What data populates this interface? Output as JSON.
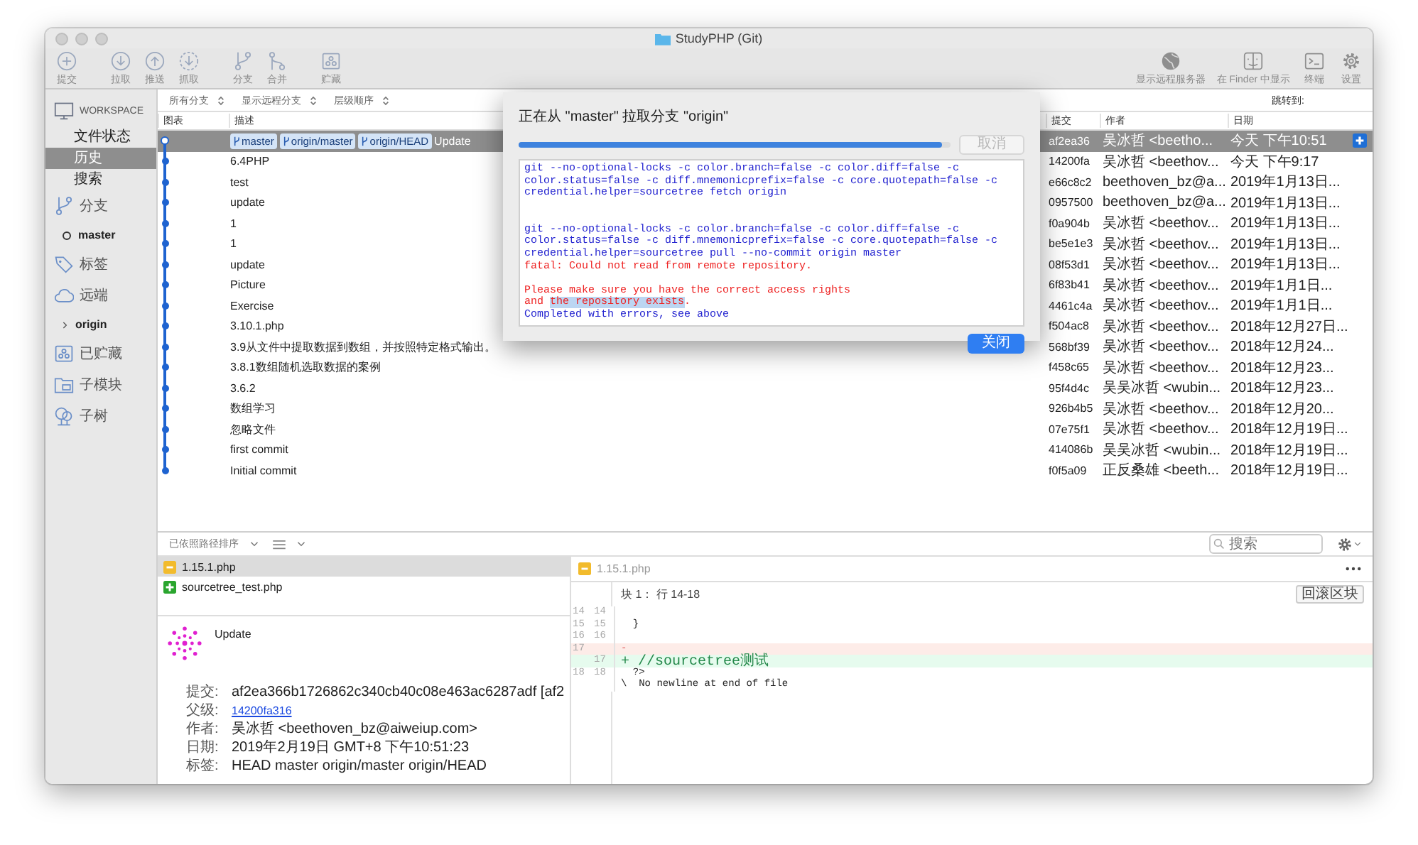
{
  "window": {
    "title": "StudyPHP (Git)"
  },
  "toolbar": {
    "left": [
      [
        {
          "label": "提交",
          "kind": "commit"
        }
      ],
      [
        {
          "label": "拉取",
          "kind": "pull"
        },
        {
          "label": "推送",
          "kind": "push"
        },
        {
          "label": "抓取",
          "kind": "fetch"
        }
      ],
      [
        {
          "label": "分支",
          "kind": "branch"
        },
        {
          "label": "合并",
          "kind": "merge"
        }
      ],
      [
        {
          "label": "贮藏",
          "kind": "stash"
        }
      ]
    ],
    "right": [
      {
        "label": "显示远程服务器",
        "kind": "globe"
      },
      {
        "label": "在 Finder 中显示",
        "kind": "finder"
      },
      {
        "label": "终端",
        "kind": "terminal"
      },
      {
        "label": "设置",
        "kind": "settings"
      }
    ]
  },
  "sidebar": {
    "items": [
      {
        "kind": "workspace",
        "label": "WORKSPACE"
      },
      {
        "kind": "item",
        "label": "文件状态",
        "selected": false
      },
      {
        "kind": "item",
        "label": "历史",
        "selected": true
      },
      {
        "kind": "item",
        "label": "搜索",
        "selected": false
      },
      {
        "kind": "branches",
        "label": "分支"
      },
      {
        "kind": "branch",
        "label": "master",
        "selected": false
      },
      {
        "kind": "tags",
        "label": "标签"
      },
      {
        "kind": "remotes",
        "label": "远端"
      },
      {
        "kind": "remote",
        "label": "origin",
        "expanded": false
      },
      {
        "kind": "stashes",
        "label": "已贮藏"
      },
      {
        "kind": "submodules",
        "label": "子模块"
      },
      {
        "kind": "subtrees",
        "label": "子树"
      }
    ]
  },
  "filters": {
    "branches": "所有分支",
    "remote": "显示远程分支",
    "order": "层级顺序",
    "jump": "跳转到:"
  },
  "columns": [
    "图表",
    "描述",
    "提交",
    "作者",
    "日期"
  ],
  "rows": [
    {
      "refs": [
        "master",
        "origin/master",
        "origin/HEAD"
      ],
      "description": "Update",
      "commit": "af2ea36",
      "author": "吴冰哲 <beetho...",
      "date": "今天 下午10:51",
      "selected": true
    },
    {
      "description": "6.4PHP",
      "commit": "14200fa",
      "author": "吴冰哲 <beethov...",
      "date": "今天 下午9:17",
      "selected": false
    },
    {
      "description": "test",
      "commit": "e66c8c2",
      "author": "beethoven_bz@a...",
      "date": "2019年1月13日...",
      "selected": false
    },
    {
      "description": "update",
      "commit": "0957500",
      "author": "beethoven_bz@a...",
      "date": "2019年1月13日...",
      "selected": false
    },
    {
      "description": "1",
      "commit": "f0a904b",
      "author": "吴冰哲 <beethov...",
      "date": "2019年1月13日...",
      "selected": false
    },
    {
      "description": "1",
      "commit": "be5e1e3",
      "author": "吴冰哲 <beethov...",
      "date": "2019年1月13日...",
      "selected": false
    },
    {
      "description": "update",
      "commit": "08f53d1",
      "author": "吴冰哲 <beethov...",
      "date": "2019年1月13日...",
      "selected": false
    },
    {
      "description": "Picture",
      "commit": "6f83b41",
      "author": "吴冰哲 <beethov...",
      "date": "2019年1月1日...",
      "selected": false
    },
    {
      "description": "Exercise",
      "commit": "4461c4a",
      "author": "吴冰哲 <beethov...",
      "date": "2019年1月1日...",
      "selected": false
    },
    {
      "description": "3.10.1.php",
      "commit": "f504ac8",
      "author": "吴冰哲 <beethov...",
      "date": "2018年12月27日...",
      "selected": false
    },
    {
      "description": "3.9从文件中提取数据到数组，并按照特定格式输出。",
      "commit": "568bf39",
      "author": "吴冰哲 <beethov...",
      "date": "2018年12月24...",
      "selected": false
    },
    {
      "description": "3.8.1数组随机选取数据的案例",
      "commit": "f458c65",
      "author": "吴冰哲 <beethov...",
      "date": "2018年12月23...",
      "selected": false
    },
    {
      "description": "3.6.2",
      "commit": "95f4d4c",
      "author": "吴吴冰哲 <wubin...",
      "date": "2018年12月23...",
      "selected": false
    },
    {
      "description": "数组学习",
      "commit": "926b4b5",
      "author": "吴冰哲 <beethov...",
      "date": "2018年12月20...",
      "selected": false
    },
    {
      "description": "忽略文件",
      "commit": "07e75f1",
      "author": "吴冰哲 <beethov...",
      "date": "2018年12月19日...",
      "selected": false
    },
    {
      "description": "first commit",
      "commit": "414086b",
      "author": "吴吴冰哲 <wubin...",
      "date": "2018年12月19日...",
      "selected": false
    },
    {
      "description": "Initial commit",
      "commit": "f0f5a09",
      "author": "正反桑雄 <beeth...",
      "date": "2018年12月19日...",
      "selected": false
    }
  ],
  "bottom": {
    "sort": "已依照路径排序",
    "search": {
      "placeholder": "搜索"
    },
    "files": [
      {
        "name": "1.15.1.php",
        "kind": "modified",
        "selected": true
      },
      {
        "name": "sourcetree_test.php",
        "kind": "added",
        "selected": false
      }
    ],
    "details": {
      "summary": "Update",
      "fields": [
        {
          "label": "提交:",
          "value": "af2ea366b1726862c340cb40c08e463ac6287adf [af2",
          "kind": "text"
        },
        {
          "label": "父级:",
          "value": "14200fa316",
          "kind": "link"
        },
        {
          "label": "作者:",
          "value": "吴冰哲 <beethoven_bz@aiweiup.com>",
          "kind": "text"
        },
        {
          "label": "日期:",
          "value": "2019年2月19日 GMT+8 下午10:51:23",
          "kind": "text"
        },
        {
          "label": "标签:",
          "value": "HEAD master origin/master origin/HEAD",
          "kind": "text"
        }
      ]
    },
    "diff": {
      "file": "1.15.1.php",
      "kind": "modified",
      "hunk": "块 1： 行 14-18",
      "discard": "回滚区块",
      "lines": [
        {
          "old": "14",
          "new": "14",
          "kind": "context"
        },
        {
          "old": "15",
          "new": "15",
          "kind": "context",
          "text": "  }"
        },
        {
          "old": "16",
          "new": "16",
          "kind": "context"
        },
        {
          "old": "17",
          "kind": "removed",
          "text": "-"
        },
        {
          "new": "17",
          "kind": "added",
          "text": "+ //sourcetree测试"
        },
        {
          "old": "18",
          "new": "18",
          "kind": "context",
          "text": "  ?>"
        },
        {
          "kind": "note",
          "text": "\\  No newline at end of file"
        }
      ]
    }
  },
  "dialog": {
    "title": "正在从 \"master\" 拉取分支 \"origin\"",
    "level": 0.98,
    "cancel": {
      "label": "取消",
      "disabled": true
    },
    "close": "关闭",
    "log": [
      [
        {
          "kind": "command",
          "parts": [
            {
              "text": "git --no-optional-locks -c color.branch=false -c color.diff=false -c",
              "highlighted": false
            }
          ]
        },
        {
          "kind": "command",
          "parts": [
            {
              "text": "color.status=false -c diff.mnemonicprefix=false -c core.quotepath=false -c",
              "highlighted": false
            }
          ]
        },
        {
          "kind": "command",
          "parts": [
            {
              "text": "credential.helper=sourcetree fetch origin",
              "highlighted": false
            }
          ]
        }
      ],
      [
        {
          "kind": "command",
          "parts": [
            {
              "text": "git --no-optional-locks -c color.branch=false -c color.diff=false -c",
              "highlighted": false
            }
          ]
        },
        {
          "kind": "command",
          "parts": [
            {
              "text": "color.status=false -c diff.mnemonicprefix=false -c core.quotepath=false -c",
              "highlighted": false
            }
          ]
        },
        {
          "kind": "command",
          "parts": [
            {
              "text": "credential.helper=sourcetree pull --no-commit origin master",
              "highlighted": false
            }
          ]
        },
        {
          "kind": "error",
          "parts": [
            {
              "text": "fatal: Could not read from remote repository.",
              "highlighted": false
            }
          ]
        }
      ],
      [
        {
          "kind": "error",
          "parts": [
            {
              "text": "Please make sure you have the correct access rights",
              "highlighted": false
            }
          ]
        },
        {
          "kind": "error",
          "parts": [
            {
              "text": "and ",
              "highlighted": false
            },
            {
              "text": "the repository exists",
              "highlighted": true
            },
            {
              "text": ".",
              "highlighted": false
            }
          ]
        },
        {
          "kind": "command",
          "parts": [
            {
              "text": "Completed with errors, see above",
              "highlighted": false
            }
          ]
        }
      ]
    ]
  }
}
